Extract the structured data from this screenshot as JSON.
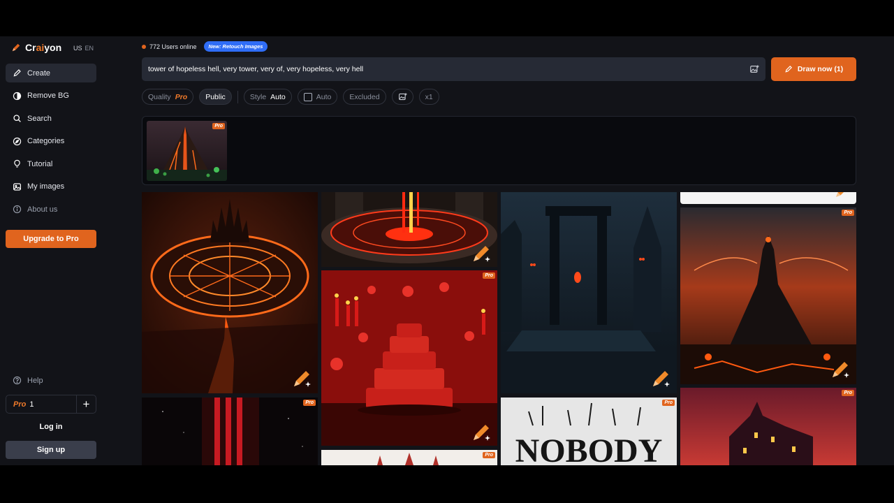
{
  "brand": {
    "name_prefix": "Cr",
    "name_accent": "ai",
    "name_suffix": "yon",
    "region": "US",
    "language": "EN",
    "accent_color": "#e0641e"
  },
  "sidebar": {
    "items": [
      {
        "label": "Create",
        "icon": "pencil-icon"
      },
      {
        "label": "Remove BG",
        "icon": "half-circle-icon"
      },
      {
        "label": "Search",
        "icon": "search-icon"
      },
      {
        "label": "Categories",
        "icon": "compass-icon"
      },
      {
        "label": "Tutorial",
        "icon": "lightbulb-icon"
      },
      {
        "label": "My images",
        "icon": "image-icon"
      },
      {
        "label": "About us",
        "icon": "info-icon"
      }
    ],
    "upgrade_label": "Upgrade to Pro",
    "help_label": "Help",
    "pro_label": "Pro",
    "pro_count": "1",
    "plus_label": "+",
    "login_label": "Log in",
    "signup_label": "Sign up"
  },
  "status": {
    "users_online": "772 Users online",
    "badge": "New: Retouch Images"
  },
  "prompt": {
    "value": "tower of hopeless hell, very tower, very of, very hopeless, very hell"
  },
  "draw_button": {
    "label": "Draw now (1)"
  },
  "options": {
    "quality_label": "Quality",
    "quality_value": "Pro",
    "visibility": "Public",
    "style_label": "Style",
    "style_value": "Auto",
    "aspect_value": "Auto",
    "excluded_label": "Excluded",
    "count": "x1"
  },
  "gallery": {
    "pro_tag": "Pro",
    "tiles": [
      {
        "subject": "ring-shaped lava citadel",
        "pro": false
      },
      {
        "subject": "glowing red rune circle",
        "pro": false
      },
      {
        "subject": "red layered cake with candles",
        "pro": true
      },
      {
        "subject": "guillotine in dark courtyard",
        "pro": false
      },
      {
        "subject": "dark tower on volcanic peak",
        "pro": true
      },
      {
        "subject": "red striped night column",
        "pro": true
      },
      {
        "subject": "black metal logo text",
        "pro": true
      },
      {
        "subject": "haunted mansion under red sky",
        "pro": true
      },
      {
        "subject": "white cake partial",
        "pro": true
      }
    ],
    "logo_text": "NOBODY"
  }
}
